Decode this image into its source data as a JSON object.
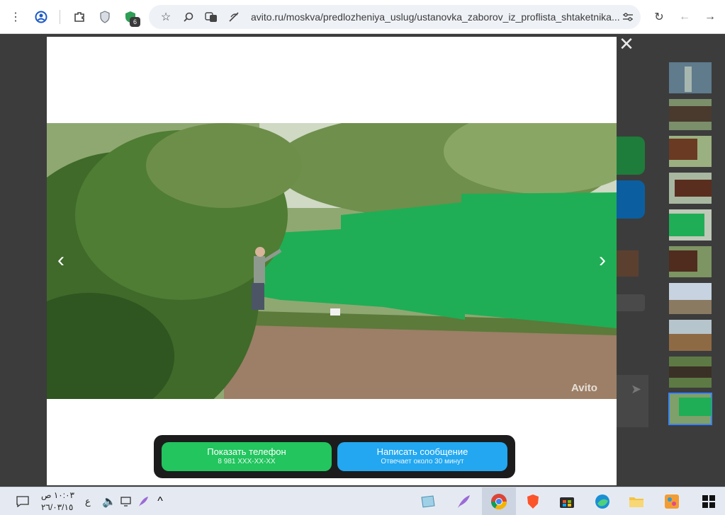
{
  "browser": {
    "url": "avito.ru/moskva/predlozheniya_uslug/ustanovka_zaborov_iz_proflista_shtaketnika...",
    "extension_badge": "6"
  },
  "viewer": {
    "watermark": "Avito",
    "thumbnail_count": 10,
    "active_thumbnail": 10
  },
  "contact": {
    "phone_label": "Показать телефон",
    "phone_number": "8 981 XXX-XX-XX",
    "message_label": "Написать сообщение",
    "message_sub": "Отвечает около 30 минут"
  },
  "taskbar": {
    "time": "١٠:٠٣ ص",
    "date": "٢٦/٠٣/١٥",
    "lang": "ع"
  },
  "colors": {
    "phone_button": "#22c55e",
    "message_button": "#22a7f0",
    "fence": "#1fae55"
  }
}
